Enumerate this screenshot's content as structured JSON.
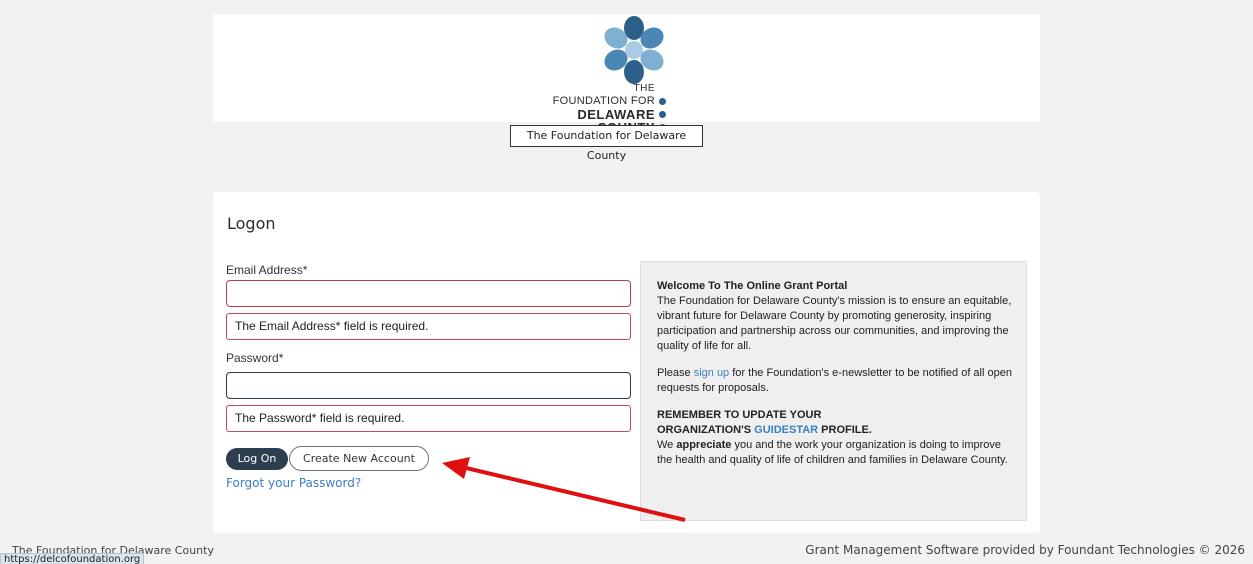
{
  "header": {
    "logo": {
      "line1": "THE",
      "line2": "FOUNDATION FOR",
      "line3": "DELAWARE",
      "line4": "COUNTY"
    },
    "caption": "The Foundation for Delaware County"
  },
  "logon": {
    "title": "Logon",
    "email_label": "Email Address*",
    "email_value": "",
    "email_error": "The Email Address* field is required.",
    "password_label": "Password*",
    "password_value": "",
    "password_error": "The Password* field is required.",
    "logon_button": "Log On",
    "create_button": "Create New Account",
    "forgot_link": "Forgot your Password?"
  },
  "info": {
    "heading": "Welcome To The Online Grant Portal",
    "mission": "The Foundation for Delaware County's mission is to ensure an equitable, vibrant future for Delaware County by promoting generosity, inspiring participation and partnership across our communities, and improving the quality of life for all.",
    "newsletter_pre": "Please ",
    "newsletter_link": "sign up",
    "newsletter_post": " for the Foundation's e-newsletter to be notified of all open requests for proposals.",
    "remember_line1": "REMEMBER TO UPDATE YOUR",
    "remember_line2_pre": "ORGANIZATION'S ",
    "remember_link": "GUIDESTAR",
    "remember_line2_post": " PROFILE.",
    "appreciate_pre": "We ",
    "appreciate_bold": "appreciate",
    "appreciate_post": " you and the work your organization is doing to improve the health and quality of life of children and families in Delaware County."
  },
  "footer": {
    "left": "The Foundation for Delaware County",
    "right": "Grant Management Software provided by Foundant Technologies © 2026",
    "status_url": "https://delcofoundation.org"
  },
  "colors": {
    "error_border": "#c24b55",
    "primary_button": "#2c3e50",
    "link": "#3b7fc4",
    "arrow": "#e01010"
  }
}
